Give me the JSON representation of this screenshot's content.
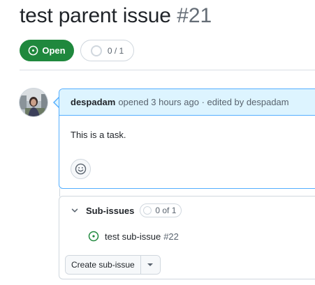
{
  "issue": {
    "title": "test parent issue",
    "number": "#21",
    "state_label": "Open",
    "progress_label": "0 / 1"
  },
  "comment": {
    "author": "despadam",
    "meta": "opened 3 hours ago · edited by despadam",
    "body": "This is a task."
  },
  "subissues": {
    "title": "Sub-issues",
    "count_label": "0 of 1",
    "items": [
      {
        "title": "test sub-issue",
        "number": "#22",
        "state": "open"
      }
    ],
    "create_button_label": "Create sub-issue"
  },
  "colors": {
    "open_green": "#1f883d",
    "highlight_border": "#54aeff",
    "highlight_header": "#ddf4ff"
  },
  "icons": {
    "state": "issue-opened-icon",
    "progress": "progress-ring-icon",
    "reaction": "smiley-icon",
    "collapse": "chevron-down-icon",
    "dropdown": "triangle-down-icon"
  }
}
